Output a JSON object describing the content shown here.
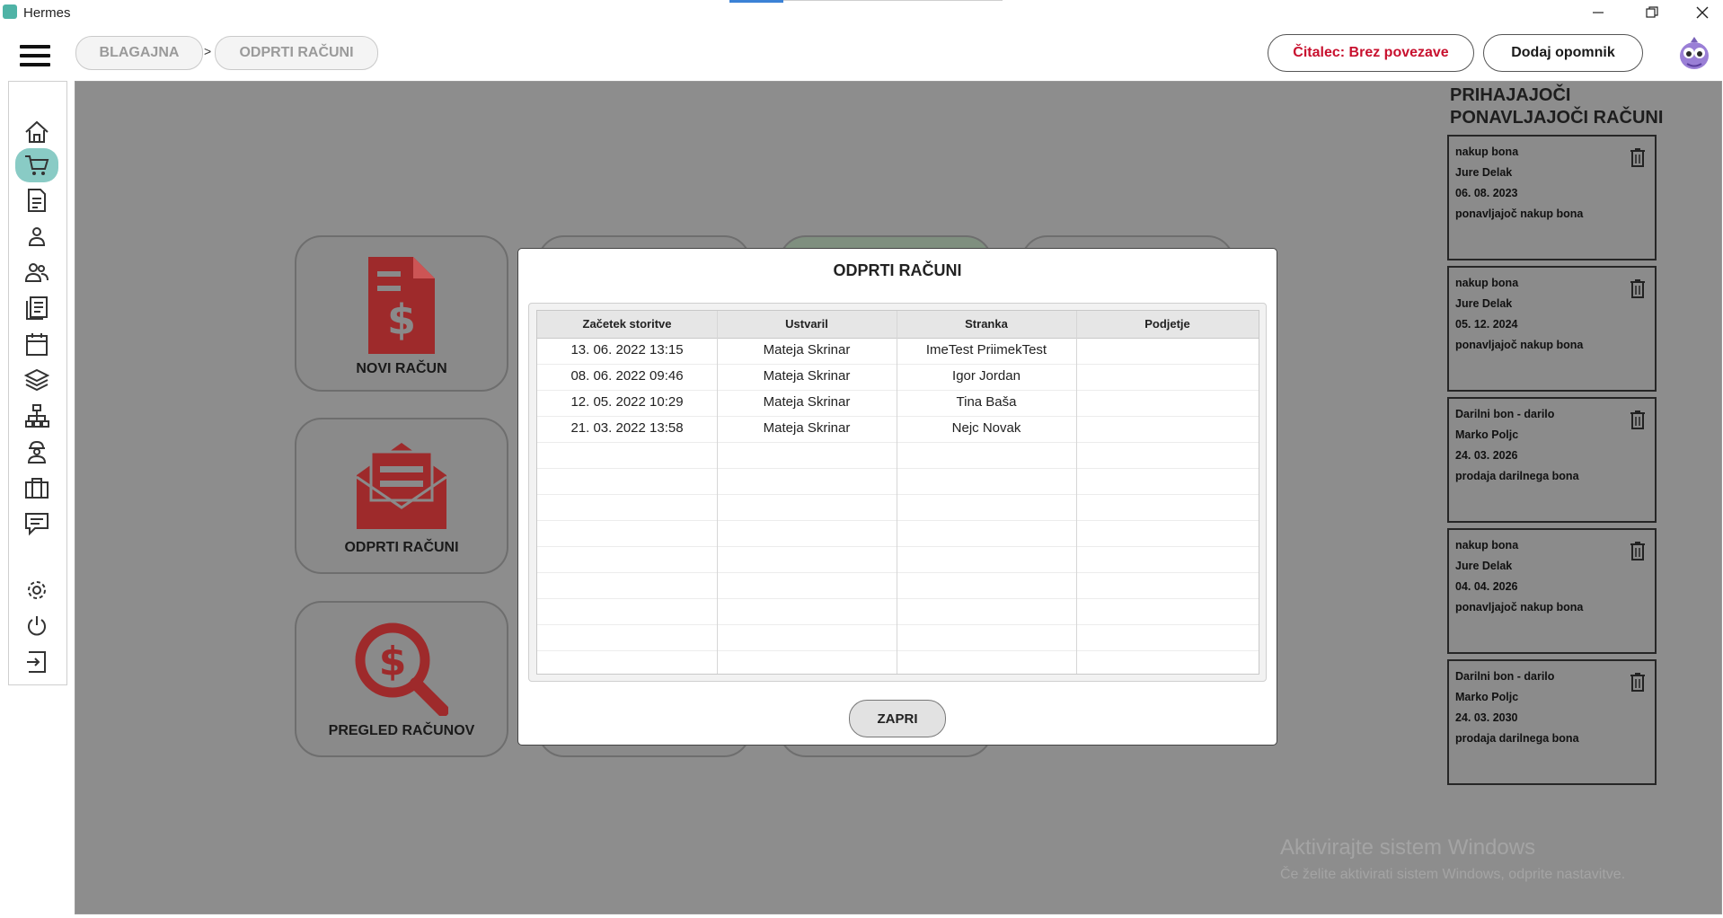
{
  "window": {
    "title": "Hermes"
  },
  "breadcrumb": {
    "items": [
      "BLAGAJNA",
      "ODPRTI RAČUNI"
    ],
    "separator": ">"
  },
  "header": {
    "reader_status": "Čitalec: Brez povezave",
    "add_reminder": "Dodaj opomnik"
  },
  "tiles": [
    {
      "label": "NOVI RAČUN",
      "icon": "invoice-dollar-icon"
    },
    {
      "label": "ODPRTI RAČUNI",
      "icon": "open-envelope-icon"
    },
    {
      "label": "PREGLED RAČUNOV",
      "icon": "dollar-search-icon"
    }
  ],
  "right_panel": {
    "title": "PRIHAJAJOČI PONAVLJAJOČI RAČUNI",
    "cards": [
      {
        "title": "nakup bona",
        "customer": "Jure Delak",
        "date": "06. 08. 2023",
        "description": "ponavljajoč nakup  bona"
      },
      {
        "title": "nakup bona",
        "customer": "Jure Delak",
        "date": "05. 12. 2024",
        "description": "ponavljajoč nakup  bona"
      },
      {
        "title": "Darilni bon - darilo",
        "customer": "Marko Poljc",
        "date": "24. 03. 2026",
        "description": "prodaja darilnega bona"
      },
      {
        "title": "nakup bona",
        "customer": "Jure Delak",
        "date": "04. 04. 2026",
        "description": "ponavljajoč nakup  bona"
      },
      {
        "title": "Darilni bon - darilo",
        "customer": "Marko Poljc",
        "date": "24. 03. 2030",
        "description": "prodaja darilnega bona"
      }
    ]
  },
  "dialog": {
    "title": "ODPRTI RAČUNI",
    "columns": [
      "Začetek storitve",
      "Ustvaril",
      "Stranka",
      "Podjetje"
    ],
    "rows": [
      [
        "13. 06. 2022 13:15",
        "Mateja Skrinar",
        "ImeTest PriimekTest",
        ""
      ],
      [
        "08. 06. 2022 09:46",
        "Mateja Skrinar",
        "Igor  Jordan",
        ""
      ],
      [
        "12. 05. 2022 10:29",
        "Mateja Skrinar",
        "Tina Baša",
        ""
      ],
      [
        "21. 03. 2022 13:58",
        "Mateja Skrinar",
        "Nejc Novak",
        ""
      ]
    ],
    "close_label": "ZAPRI"
  },
  "watermark": {
    "line1": "Aktivirajte sistem Windows",
    "line2": "Če želite aktivirati sistem Windows, odprite nastavitve."
  },
  "sidebar": {
    "icons": [
      "home-icon",
      "cart-icon",
      "document-icon",
      "person-icon",
      "people-icon",
      "list-document-icon",
      "calendar-icon",
      "layers-icon",
      "hierarchy-icon",
      "worker-icon",
      "briefcase-icon",
      "chat-icon",
      "gear-icon",
      "power-icon",
      "logout-icon"
    ],
    "active": "cart-icon"
  },
  "colors": {
    "accent": "#89cbc5",
    "brand_red": "#9e2a2b",
    "overlay": "#8d8d8d"
  }
}
